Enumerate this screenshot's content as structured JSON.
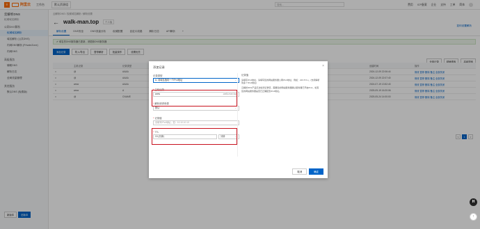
{
  "topbar": {
    "brand": "阿里云",
    "menu_icon": "menu-icon",
    "workbench": "工作台",
    "env": "默认资源组",
    "search_placeholder": "搜索...",
    "links": [
      "费用",
      "ICP备案",
      "企业",
      "支持",
      "工单"
    ],
    "lang": "简体"
  },
  "sidebar": {
    "title": "云解析DNS",
    "sub": "权威域名解析",
    "groups": [
      {
        "label": "公网DNS解析",
        "items": [
          "权威域名解析",
          "域名解析 (公共DNS)",
          "内网DNS解析 (PrivateZone)",
          "内网DNS"
        ]
      },
      {
        "label": "高级服务",
        "items": [
          "辅助DNS",
          "解析日志",
          "全局流量管理"
        ]
      },
      {
        "label": "其他服务",
        "items": [
          "默认DNS (免费版)"
        ]
      }
    ],
    "bottom": [
      "新版本",
      "旧版本"
    ]
  },
  "main": {
    "crumbs": "云解析DNS / 权威域名解析 / 解析设置",
    "title": "walk-man.top",
    "badge": "个人版",
    "help": "如何设置解析",
    "tabs": [
      "解析设置",
      "DNS安全",
      "DNS流量分析",
      "权威配置",
      "自定义线路",
      "解析日志",
      "API解析",
      "+"
    ],
    "notice": "✔ 域名的DNS服务器已更新，请更新DNS服务器",
    "actions": [
      "添加记录",
      "导入/导出",
      "暂停解析",
      "批量操作",
      "设置优先"
    ],
    "filters": [
      "全部记录",
      "精确搜索",
      "高级搜索"
    ],
    "table": {
      "headers": [
        "",
        "主机记录",
        "记录类型",
        "解析线路(运营商)",
        "记录值",
        "创建时间",
        "操作"
      ],
      "rows": [
        [
          "",
          "@",
          "AAAA",
          "默认",
          "",
          "2024-12-09 22:06:44",
          "修改 暂停 删除 备注 全部关闭"
        ],
        [
          "",
          "@",
          "AAAA",
          "默认",
          "",
          "2024-12-09 22:07:40",
          "修改 暂停 删除 备注 全部关闭"
        ],
        [
          "",
          "www",
          "AAAA",
          "默认",
          "",
          "2024-07-19 13:52:40",
          "修改 暂停 删除 备注 全部关闭"
        ],
        [
          "",
          "www",
          "A",
          "默认",
          "",
          "2025-09-19 16:20:06",
          "修改 暂停 删除 备注 全部关闭"
        ],
        [
          "",
          "@",
          "CNAME",
          "默认",
          "",
          "2025-05-24 14:00:00",
          "修改 暂停 删除 备注 全部关闭"
        ]
      ]
    },
    "pager": [
      "<",
      "1",
      ">"
    ]
  },
  "dialog": {
    "title": "添加记录",
    "close": "×",
    "record_type_label": "记录类型",
    "record_type_value": "A- 将域名指向一个IPv4地址",
    "host_label": "主机记录",
    "host_value": "www",
    "host_suffix": ".walk-man.top",
    "line_label": "解析请求来源",
    "line_value": "默认",
    "value_label": "记录值",
    "value_placeholder": "请填写IPv4地址，如：10.10.10.10",
    "ttl_label": "TTL",
    "ttl_value": "10 (分钟)",
    "ttl_unit": "分钟",
    "help_title": "记录值",
    "help_text_1": "请填写IPv4地址，请填写您的网站服务器公网IPv4地址，例如：223.5.5.x。(支持解析到多个IPv4地址)",
    "help_text_2": "云解析DNS产品无法检测记录值，需要您的网站服务器确认服务器已开启IPv4，检查您的网站服务器是否已正确配置IPv4地址。",
    "cancel": "取消",
    "ok": "确定",
    "highlight_color": "#c8101c"
  },
  "floating": {
    "h": "H",
    "up": "↑"
  }
}
